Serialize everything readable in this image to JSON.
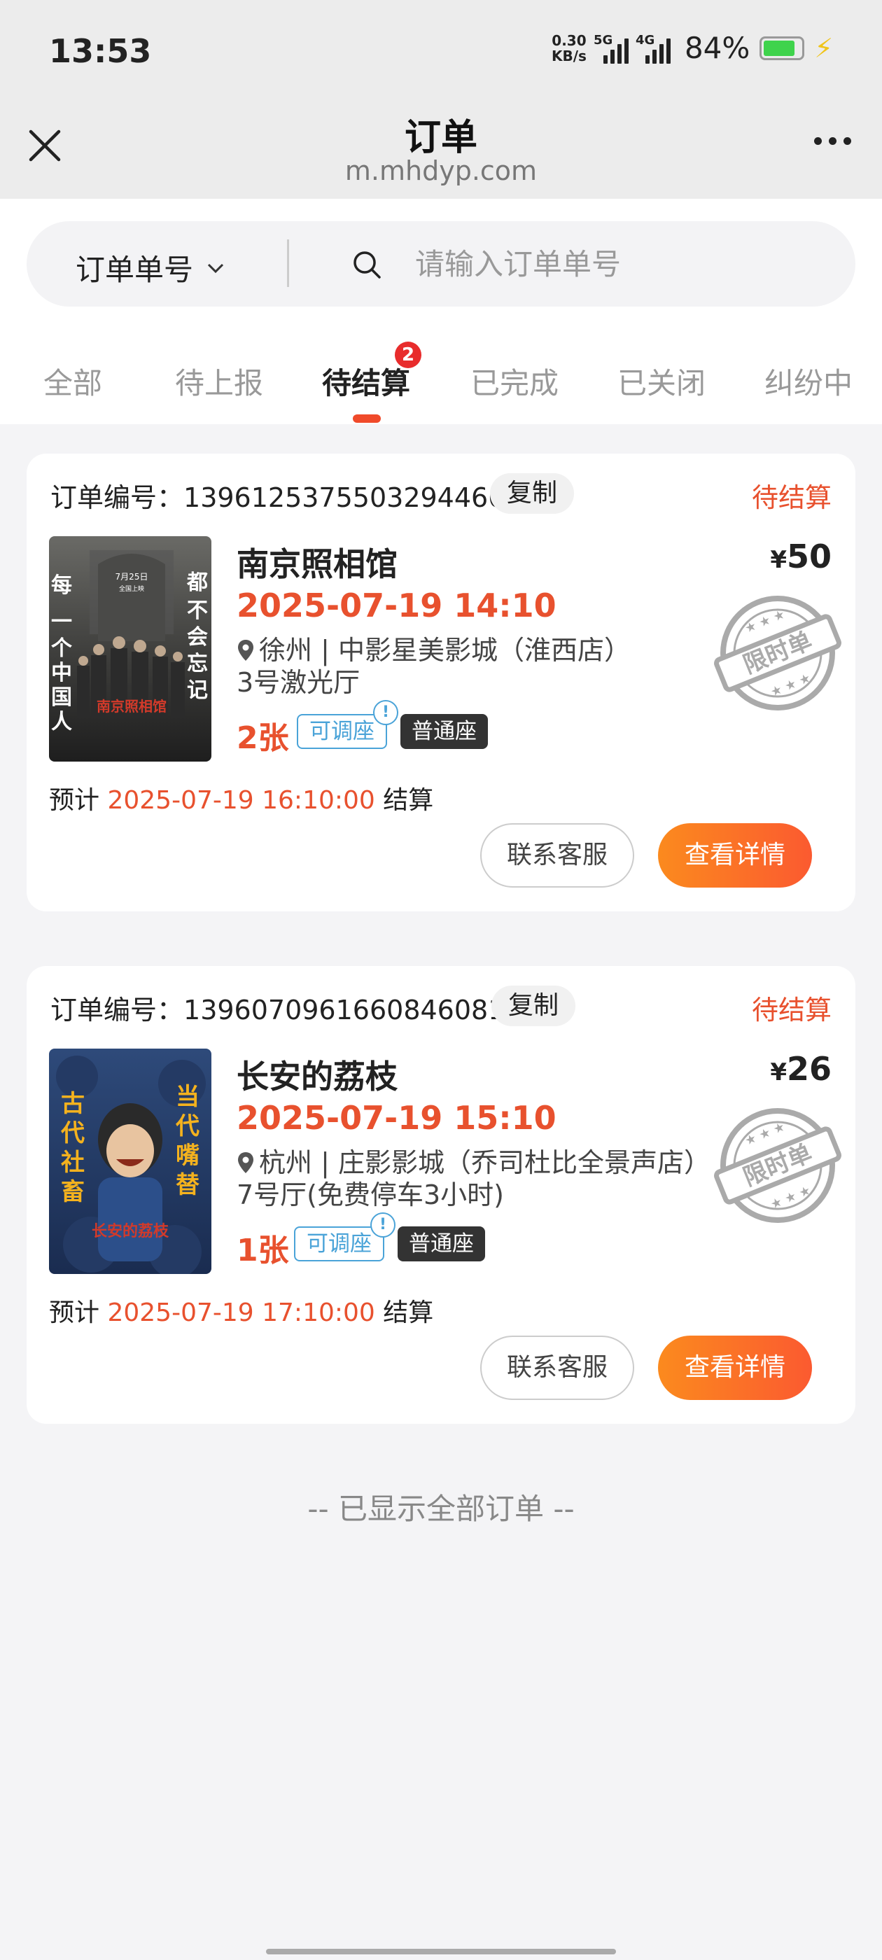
{
  "status_bar": {
    "time": "13:53",
    "net_speed_value": "0.30",
    "net_speed_unit": "KB/s",
    "sim1": "5G",
    "sim2": "4G",
    "battery_percent": "84%",
    "battery_level": 0.84,
    "battery_color": "#3fd34c"
  },
  "header": {
    "title": "订单",
    "subtitle": "m.mhdyp.com"
  },
  "search": {
    "filter_label": "订单单号",
    "placeholder": "请输入订单单号"
  },
  "tabs": [
    {
      "label": "全部"
    },
    {
      "label": "待上报"
    },
    {
      "label": "待结算",
      "badge": "2",
      "active": true
    },
    {
      "label": "已完成"
    },
    {
      "label": "已关闭"
    },
    {
      "label": "纠纷中"
    }
  ],
  "orders": [
    {
      "order_no_label": "订单编号：",
      "order_no": "1396125375503294466",
      "copy_label": "复制",
      "status": "待结算",
      "poster": {
        "top_date": "7月25日",
        "top_sub": "全国上映",
        "left_text": "每一个中国人",
        "right_text": "都不会忘记",
        "title_text": "南京照相馆"
      },
      "movie_title": "南京照相馆",
      "show_time": "2025-07-19 14:10",
      "address": "徐州 | 中影星美影城（淮西店）",
      "hall": "3号激光厅",
      "ticket_count": "2张",
      "tag_adjust": "可调座",
      "tag_seat": "普通座",
      "currency": "¥",
      "price": "50",
      "stamp_text": "限时单",
      "settle_prefix": "预计",
      "settle_time": "2025-07-19 16:10:00",
      "settle_suffix": "结算",
      "contact_label": "联系客服",
      "detail_label": "查看详情"
    },
    {
      "order_no_label": "订单编号：",
      "order_no": "1396070961660846081",
      "copy_label": "复制",
      "status": "待结算",
      "poster": {
        "left_text": "古代社畜",
        "right_text": "当代嘴替",
        "title_text": "长安的荔枝"
      },
      "movie_title": "长安的荔枝",
      "show_time": "2025-07-19 15:10",
      "address": "杭州 | 庄影影城（乔司杜比全景声店）",
      "hall": "7号厅(免费停车3小时)",
      "ticket_count": "1张",
      "tag_adjust": "可调座",
      "tag_seat": "普通座",
      "currency": "¥",
      "price": "26",
      "stamp_text": "限时单",
      "settle_prefix": "预计",
      "settle_time": "2025-07-19 17:10:00",
      "settle_suffix": "结算",
      "contact_label": "联系客服",
      "detail_label": "查看详情"
    }
  ],
  "end_note": "-- 已显示全部订单 --",
  "colors": {
    "accent": "#e8512e",
    "button_gradient_start": "#fb8a1e",
    "button_gradient_end": "#fb5a30",
    "tag_blue": "#4aa3d8"
  }
}
